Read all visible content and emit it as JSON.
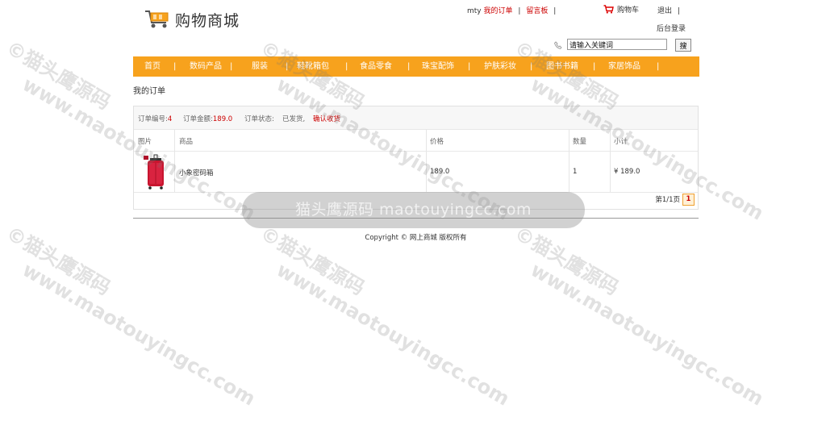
{
  "header": {
    "site_title": "购物商城",
    "user": "mty",
    "my_orders": "我的订单",
    "sep": "|",
    "message_board": "留言板",
    "cart": "购物车",
    "logout": "退出",
    "logout_sep": "|",
    "admin_login": "后台登录"
  },
  "search": {
    "value": "请输入关键词",
    "button": "搜"
  },
  "nav": {
    "items": [
      "首页",
      "数码产品",
      "服装",
      "鞋靴箱包",
      "食品零食",
      "珠宝配饰",
      "护肤彩妆",
      "图书书籍",
      "家居饰品"
    ],
    "separator": "|"
  },
  "breadcrumb": "我的订单",
  "order": {
    "number_label": "订单编号:",
    "number": "4",
    "amount_label": "订单金额:",
    "amount": "189.0",
    "status_label": "订单状态:",
    "status": "已发货,",
    "confirm": "确认收货"
  },
  "table": {
    "headers": [
      "图片",
      "商品",
      "价格",
      "数量",
      "小计"
    ],
    "rows": [
      {
        "name": "小象密码箱",
        "price": "189.0",
        "qty": "1",
        "subtotal": "¥ 189.0"
      }
    ]
  },
  "pager": {
    "text": "第1/1页",
    "current": "1"
  },
  "footer": "Copyright © 网上商城 版权所有",
  "watermark": {
    "line1": "©猫头鹰源码",
    "line2": "www.maotouyingcc.com",
    "banner": "猫头鹰源码 maotouyingcc.com"
  },
  "colors": {
    "accent": "#f7a21d",
    "link_red": "#cc0000",
    "text": "#333333"
  }
}
